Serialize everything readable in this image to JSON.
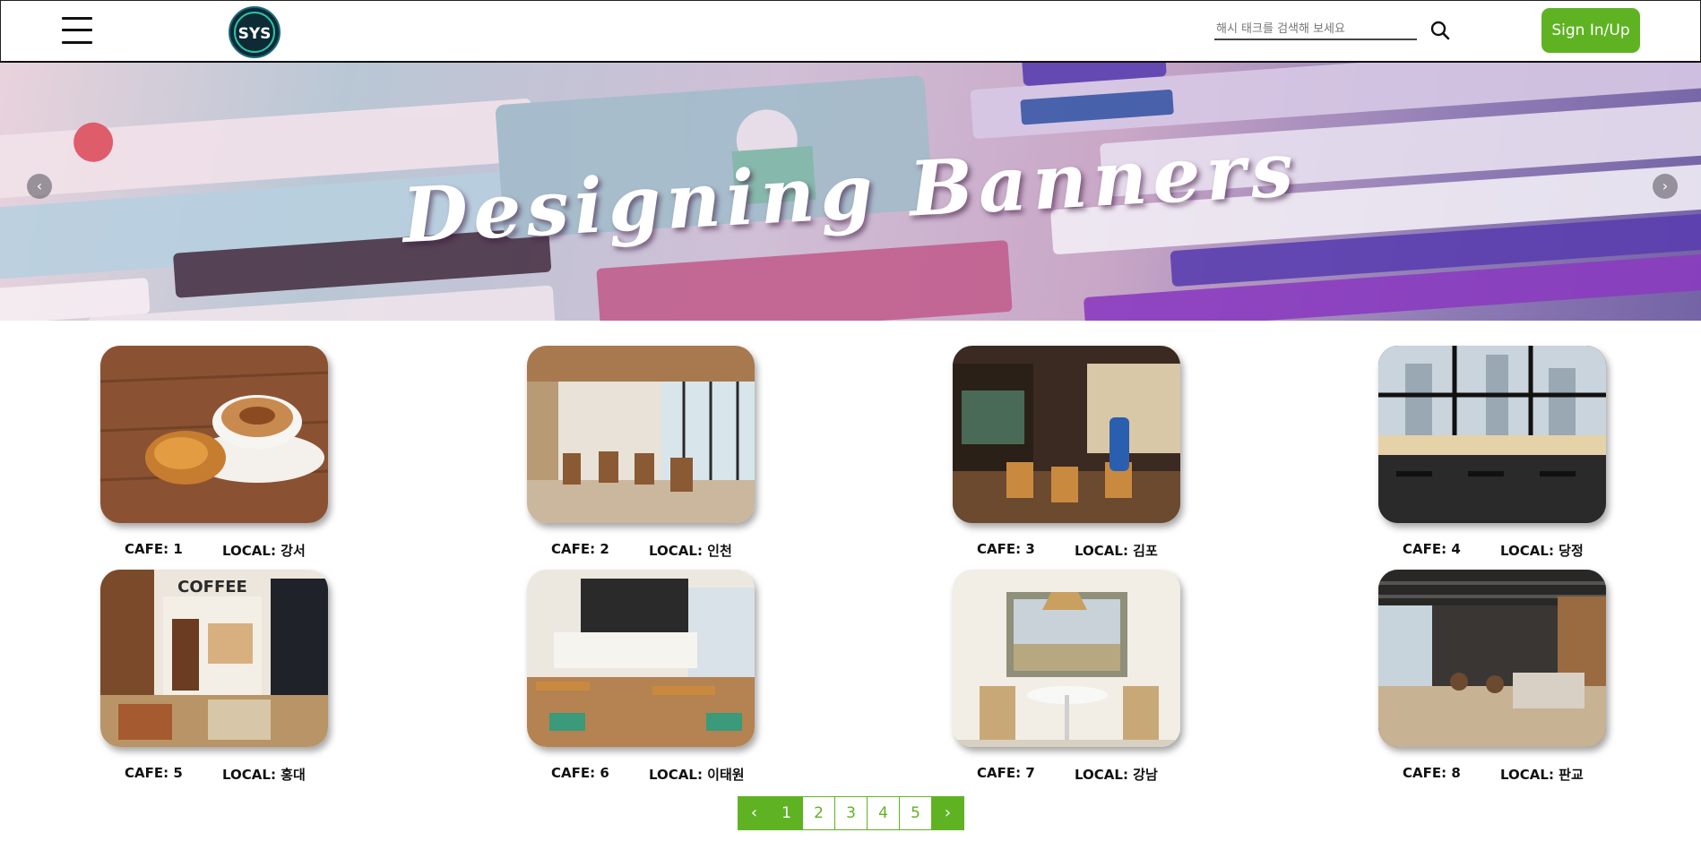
{
  "header": {
    "logo_text": "SYS",
    "search_placeholder": "해시 태크를 검색해 보세요",
    "signin_label": "Sign In/Up"
  },
  "banner": {
    "title": "Designing Banners",
    "prev_icon": "chevron-left-icon",
    "next_icon": "chevron-right-icon"
  },
  "cafes": [
    {
      "cafe": "CAFE: 1",
      "local": "LOCAL: 강서"
    },
    {
      "cafe": "CAFE: 2",
      "local": "LOCAL: 인천"
    },
    {
      "cafe": "CAFE: 3",
      "local": "LOCAL: 김포"
    },
    {
      "cafe": "CAFE: 4",
      "local": "LOCAL: 당정"
    },
    {
      "cafe": "CAFE: 5",
      "local": "LOCAL: 홍대"
    },
    {
      "cafe": "CAFE: 6",
      "local": "LOCAL: 이태원"
    },
    {
      "cafe": "CAFE: 7",
      "local": "LOCAL: 강남"
    },
    {
      "cafe": "CAFE: 8",
      "local": "LOCAL: 판교"
    }
  ],
  "pagination": {
    "prev": "‹",
    "pages": [
      "1",
      "2",
      "3",
      "4",
      "5"
    ],
    "current": "1",
    "next": "›"
  },
  "colors": {
    "accent": "#5fb323"
  }
}
